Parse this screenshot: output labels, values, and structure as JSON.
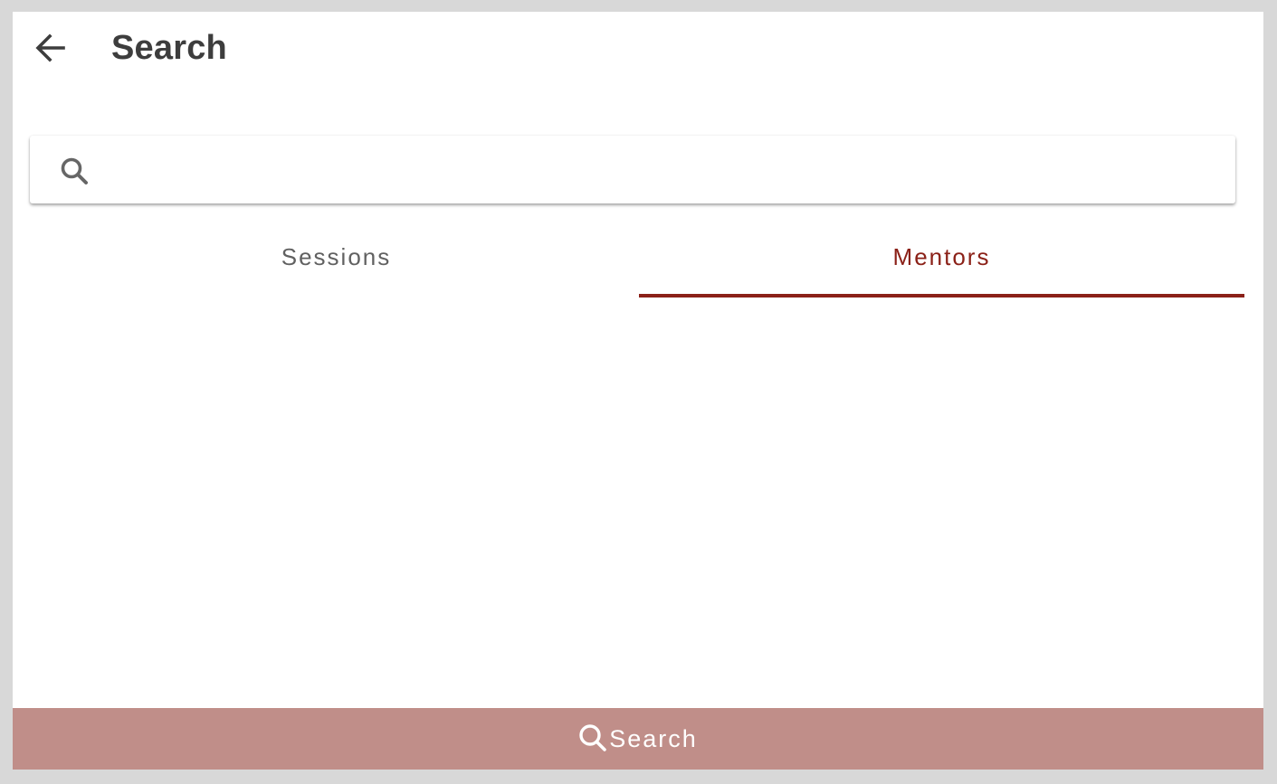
{
  "header": {
    "back_icon": "arrow-left-icon",
    "title": "Search"
  },
  "search": {
    "icon": "search-icon",
    "value": "",
    "placeholder": ""
  },
  "tabs": [
    {
      "label": "Sessions",
      "active": false
    },
    {
      "label": "Mentors",
      "active": true
    }
  ],
  "bottom_button": {
    "icon": "search-icon",
    "label": "Search"
  },
  "colors": {
    "accent": "#8b2118",
    "bottom_bar": "#c08e89",
    "title": "#3d3d3d",
    "inactive_tab": "#616161",
    "background": "#d8d8d8"
  }
}
